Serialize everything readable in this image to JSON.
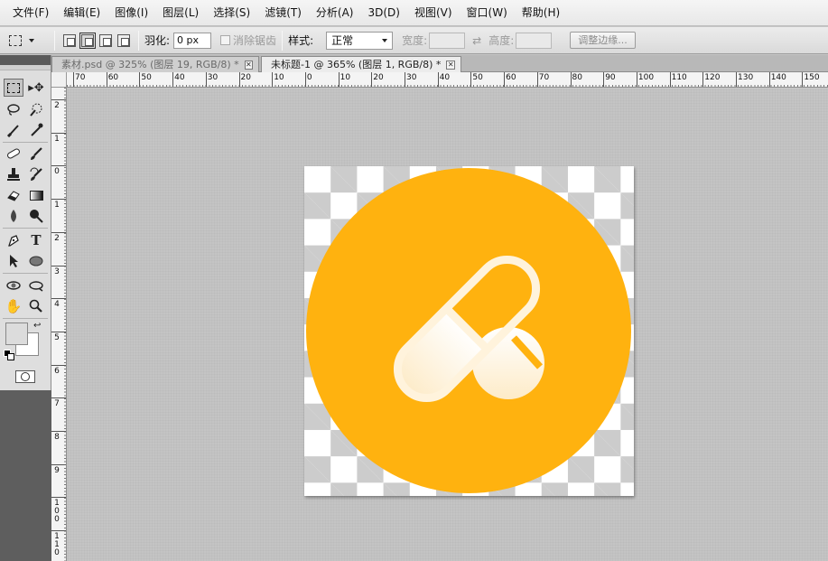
{
  "menu": [
    "文件(F)",
    "编辑(E)",
    "图像(I)",
    "图层(L)",
    "选择(S)",
    "滤镜(T)",
    "分析(A)",
    "3D(D)",
    "视图(V)",
    "窗口(W)",
    "帮助(H)"
  ],
  "options": {
    "feather_label": "羽化:",
    "feather_value": "0 px",
    "antialias_label": "消除锯齿",
    "style_label": "样式:",
    "style_value": "正常",
    "width_label": "宽度:",
    "height_label": "高度:",
    "refine_edge_label": "调整边缘..."
  },
  "tabs": [
    {
      "title": "素材.psd @ 325% (图层 19, RGB/8) *",
      "active": false
    },
    {
      "title": "未标题-1 @ 365% (图层 1, RGB/8) *",
      "active": true
    }
  ],
  "hruler_labels": [
    "70",
    "60",
    "50",
    "40",
    "30",
    "20",
    "10",
    "0",
    "10",
    "20",
    "30",
    "40",
    "50",
    "60",
    "70",
    "80",
    "90",
    "100",
    "110",
    "120",
    "130",
    "140",
    "150"
  ],
  "vruler_labels": [
    "2",
    "1",
    "0",
    "1",
    "2",
    "3",
    "4",
    "5",
    "6",
    "7",
    "8",
    "9",
    "100",
    "110"
  ],
  "colors": {
    "icon_circle": "#FFB20F",
    "pill_stroke": "#FFF3DC",
    "pill_fill_light": "#FFF8EC",
    "foreground_swatch": "#DCDCDC",
    "background_swatch": "#FFFFFF"
  },
  "tools": [
    "rect-marquee-icon",
    "move-icon",
    "lasso-icon",
    "quick-selection-icon",
    "crop-icon",
    "eyedropper-icon",
    "spot-healing-icon",
    "brush-icon",
    "clone-stamp-icon",
    "history-brush-icon",
    "eraser-icon",
    "gradient-icon",
    "blur-icon",
    "dodge-icon",
    "pen-icon",
    "type-icon",
    "path-selection-icon",
    "ellipse-shape-icon",
    "3d-rotate-icon",
    "3d-orbit-icon",
    "hand-icon",
    "zoom-icon"
  ]
}
